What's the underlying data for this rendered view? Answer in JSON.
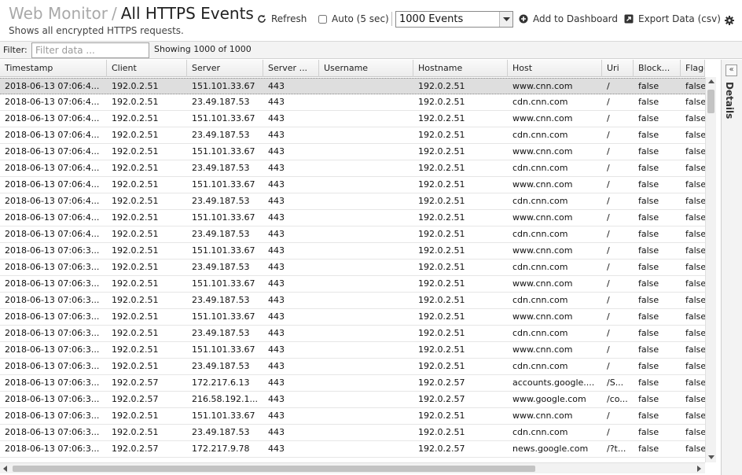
{
  "header": {
    "breadcrumb": "Web Monitor",
    "separator": "/",
    "title": "All HTTPS Events",
    "subtitle": "Shows all encrypted HTTPS requests."
  },
  "toolbar": {
    "refresh_label": "Refresh",
    "auto_label": "Auto (5 sec)",
    "auto_checked": false,
    "events_selected": "1000 Events",
    "add_dashboard_label": "Add to Dashboard",
    "export_label": "Export Data (csv)"
  },
  "filter": {
    "label": "Filter:",
    "placeholder": "Filter data ...",
    "value": "",
    "showing": "Showing 1000 of 1000"
  },
  "details": {
    "collapse_glyph": "«",
    "label": "Details"
  },
  "table": {
    "columns": [
      "Timestamp",
      "Client",
      "Server",
      "Server ...",
      "Username",
      "Hostname",
      "Host",
      "Uri",
      "Block...",
      "Flagg..."
    ],
    "rows": [
      [
        "2018-06-13 07:06:4...",
        "192.0.2.51",
        "151.101.33.67",
        "443",
        "",
        "192.0.2.51",
        "www.cnn.com",
        "/",
        "false",
        "false"
      ],
      [
        "2018-06-13 07:06:4...",
        "192.0.2.51",
        "23.49.187.53",
        "443",
        "",
        "192.0.2.51",
        "cdn.cnn.com",
        "/",
        "false",
        "false"
      ],
      [
        "2018-06-13 07:06:4...",
        "192.0.2.51",
        "151.101.33.67",
        "443",
        "",
        "192.0.2.51",
        "www.cnn.com",
        "/",
        "false",
        "false"
      ],
      [
        "2018-06-13 07:06:4...",
        "192.0.2.51",
        "23.49.187.53",
        "443",
        "",
        "192.0.2.51",
        "cdn.cnn.com",
        "/",
        "false",
        "false"
      ],
      [
        "2018-06-13 07:06:4...",
        "192.0.2.51",
        "151.101.33.67",
        "443",
        "",
        "192.0.2.51",
        "www.cnn.com",
        "/",
        "false",
        "false"
      ],
      [
        "2018-06-13 07:06:4...",
        "192.0.2.51",
        "23.49.187.53",
        "443",
        "",
        "192.0.2.51",
        "cdn.cnn.com",
        "/",
        "false",
        "false"
      ],
      [
        "2018-06-13 07:06:4...",
        "192.0.2.51",
        "151.101.33.67",
        "443",
        "",
        "192.0.2.51",
        "www.cnn.com",
        "/",
        "false",
        "false"
      ],
      [
        "2018-06-13 07:06:4...",
        "192.0.2.51",
        "23.49.187.53",
        "443",
        "",
        "192.0.2.51",
        "cdn.cnn.com",
        "/",
        "false",
        "false"
      ],
      [
        "2018-06-13 07:06:4...",
        "192.0.2.51",
        "151.101.33.67",
        "443",
        "",
        "192.0.2.51",
        "www.cnn.com",
        "/",
        "false",
        "false"
      ],
      [
        "2018-06-13 07:06:4...",
        "192.0.2.51",
        "23.49.187.53",
        "443",
        "",
        "192.0.2.51",
        "cdn.cnn.com",
        "/",
        "false",
        "false"
      ],
      [
        "2018-06-13 07:06:3...",
        "192.0.2.51",
        "151.101.33.67",
        "443",
        "",
        "192.0.2.51",
        "www.cnn.com",
        "/",
        "false",
        "false"
      ],
      [
        "2018-06-13 07:06:3...",
        "192.0.2.51",
        "23.49.187.53",
        "443",
        "",
        "192.0.2.51",
        "cdn.cnn.com",
        "/",
        "false",
        "false"
      ],
      [
        "2018-06-13 07:06:3...",
        "192.0.2.51",
        "151.101.33.67",
        "443",
        "",
        "192.0.2.51",
        "www.cnn.com",
        "/",
        "false",
        "false"
      ],
      [
        "2018-06-13 07:06:3...",
        "192.0.2.51",
        "23.49.187.53",
        "443",
        "",
        "192.0.2.51",
        "cdn.cnn.com",
        "/",
        "false",
        "false"
      ],
      [
        "2018-06-13 07:06:3...",
        "192.0.2.51",
        "151.101.33.67",
        "443",
        "",
        "192.0.2.51",
        "www.cnn.com",
        "/",
        "false",
        "false"
      ],
      [
        "2018-06-13 07:06:3...",
        "192.0.2.51",
        "23.49.187.53",
        "443",
        "",
        "192.0.2.51",
        "cdn.cnn.com",
        "/",
        "false",
        "false"
      ],
      [
        "2018-06-13 07:06:3...",
        "192.0.2.51",
        "151.101.33.67",
        "443",
        "",
        "192.0.2.51",
        "www.cnn.com",
        "/",
        "false",
        "false"
      ],
      [
        "2018-06-13 07:06:3...",
        "192.0.2.51",
        "23.49.187.53",
        "443",
        "",
        "192.0.2.51",
        "cdn.cnn.com",
        "/",
        "false",
        "false"
      ],
      [
        "2018-06-13 07:06:3...",
        "192.0.2.57",
        "172.217.6.13",
        "443",
        "",
        "192.0.2.57",
        "accounts.google....",
        "/S...",
        "false",
        "false"
      ],
      [
        "2018-06-13 07:06:3...",
        "192.0.2.57",
        "216.58.192.1...",
        "443",
        "",
        "192.0.2.57",
        "www.google.com",
        "/co...",
        "false",
        "false"
      ],
      [
        "2018-06-13 07:06:3...",
        "192.0.2.51",
        "151.101.33.67",
        "443",
        "",
        "192.0.2.51",
        "www.cnn.com",
        "/",
        "false",
        "false"
      ],
      [
        "2018-06-13 07:06:3...",
        "192.0.2.51",
        "23.49.187.53",
        "443",
        "",
        "192.0.2.51",
        "cdn.cnn.com",
        "/",
        "false",
        "false"
      ],
      [
        "2018-06-13 07:06:3...",
        "192.0.2.57",
        "172.217.9.78",
        "443",
        "",
        "192.0.2.57",
        "news.google.com",
        "/?t...",
        "false",
        "false"
      ]
    ]
  }
}
